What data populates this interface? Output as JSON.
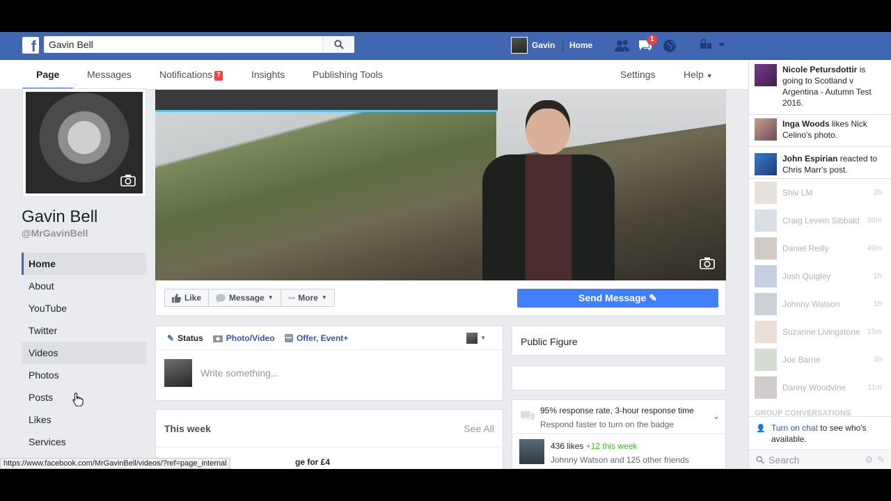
{
  "topbar": {
    "search_value": "Gavin Bell",
    "profile_name": "Gavin",
    "home_label": "Home",
    "notification_count": "1",
    "brand_color": "#4267b2"
  },
  "tabs": [
    {
      "label": "Page"
    },
    {
      "label": "Messages"
    },
    {
      "label": "Notifications",
      "badge": "7"
    },
    {
      "label": "Insights"
    },
    {
      "label": "Publishing Tools"
    },
    {
      "label": "Settings"
    },
    {
      "label": "Help"
    }
  ],
  "page": {
    "name": "Gavin Bell",
    "handle": "@MrGavinBell"
  },
  "left_nav": [
    {
      "label": "Home"
    },
    {
      "label": "About"
    },
    {
      "label": "YouTube"
    },
    {
      "label": "Twitter"
    },
    {
      "label": "Videos"
    },
    {
      "label": "Photos"
    },
    {
      "label": "Posts"
    },
    {
      "label": "Likes"
    },
    {
      "label": "Services"
    }
  ],
  "actions": {
    "like": "Like",
    "message": "Message",
    "more": "More",
    "send_message": "Send Message"
  },
  "composer": {
    "status_tab": "Status",
    "photo_tab": "Photo/Video",
    "offer_tab": "Offer, Event+",
    "placeholder": "Write something..."
  },
  "this_week": {
    "title": "This week",
    "see_all": "See All",
    "row_text": "ge for £4"
  },
  "right_cards": {
    "category": "Public Figure",
    "response_rate": "95% response rate, 3-hour response time",
    "response_hint": "Respond faster to turn on the badge",
    "likes": "436 likes",
    "likes_delta": "+12 this week",
    "friends_like": "Johnny Watson and 125 other friends"
  },
  "ticker": [
    {
      "name": "Nicole Petursdottir",
      "text": "is going to Scotland v Argentina - Autumn Test 2016."
    },
    {
      "name": "Inga Woods",
      "text": "likes Nick Celino's photo."
    },
    {
      "name": "John Espirian",
      "text": "reacted to Chris Marr's post."
    }
  ],
  "chat": [
    {
      "name": "Shiv LM",
      "time": "2h"
    },
    {
      "name": "Craig Levein Sibbald",
      "time": "39m"
    },
    {
      "name": "Daniel Reilly",
      "time": "49m"
    },
    {
      "name": "Josh Quigley",
      "time": "1h"
    },
    {
      "name": "Johnny Watson",
      "time": "1h"
    },
    {
      "name": "Suzanne Livingstone",
      "time": "15m"
    },
    {
      "name": "Joe Barrie",
      "time": "3h"
    },
    {
      "name": "Danny Woodvine",
      "time": "11m"
    }
  ],
  "chat_footer": {
    "group_heading": "GROUP CONVERSATIONS",
    "turn_on_link": "Turn on chat",
    "turn_on_rest": "to see who's available.",
    "search_placeholder": "Search"
  },
  "status_url": "https://www.facebook.com/MrGavinBell/videos/?ref=page_internal"
}
